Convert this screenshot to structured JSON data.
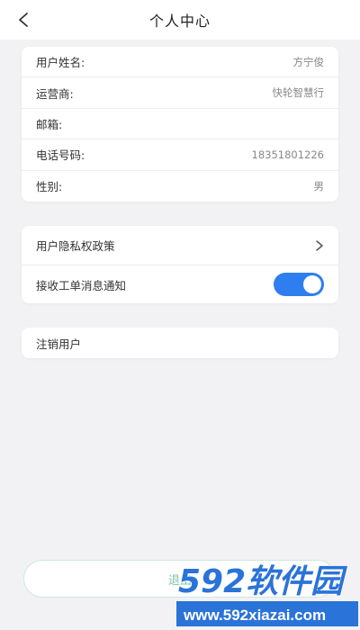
{
  "header": {
    "title": "个人中心"
  },
  "profile": {
    "rows": [
      {
        "label": "用户姓名:",
        "value": "方宁俊"
      },
      {
        "label": "运营商:",
        "value": "快轮智慧行"
      },
      {
        "label": "邮箱:",
        "value": ""
      },
      {
        "label": "电话号码:",
        "value": "18351801226"
      },
      {
        "label": "性别:",
        "value": "男"
      }
    ]
  },
  "settings": {
    "privacy_label": "用户隐私权政策",
    "notify_label": "接收工单消息通知",
    "notify_enabled": true
  },
  "account": {
    "deactivate_label": "注销用户"
  },
  "logout": {
    "label": "退出"
  },
  "watermark": {
    "logo": "592软件园",
    "url": "www.592xiazai.com"
  },
  "colors": {
    "toggle_on": "#2f7ef0",
    "logout_text": "#7cc4ae",
    "watermark_blue": "#2a73d8"
  }
}
